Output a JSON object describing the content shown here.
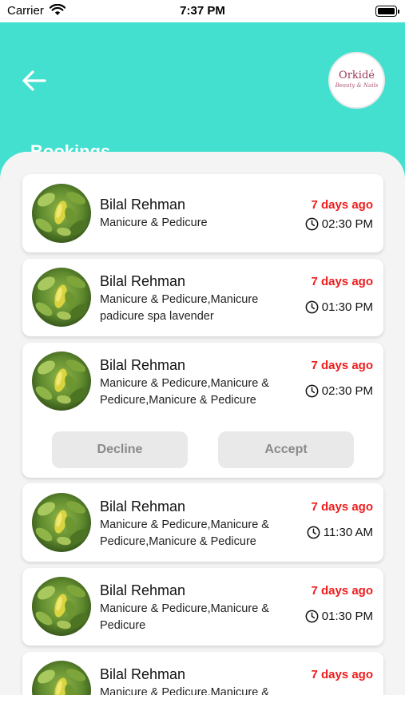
{
  "status_bar": {
    "carrier": "Carrier",
    "time": "7:37 PM"
  },
  "header": {
    "title": "Bookings",
    "logo": {
      "name": "Orkidé",
      "tagline": "Beauty & Nails"
    }
  },
  "colors": {
    "header_bg": "#43e0cf",
    "ago_red": "#ef1c1c",
    "button_gray": "#e9e9e9"
  },
  "icons": {
    "back": "arrow-left-icon",
    "clock": "clock-icon",
    "wifi": "wifi-icon",
    "battery": "battery-icon"
  },
  "bookings": [
    {
      "name": "Bilal Rehman",
      "service": "Manicure & Pedicure",
      "ago": "7 days ago",
      "time": "02:30 PM"
    },
    {
      "name": "Bilal Rehman",
      "service": "Manicure & Pedicure,Manicure padicure spa lavender",
      "ago": "7 days ago",
      "time": "01:30 PM"
    },
    {
      "name": "Bilal Rehman",
      "service": "Manicure & Pedicure,Manicure & Pedicure,Manicure & Pedicure",
      "ago": "7 days ago",
      "time": "02:30 PM",
      "decline_label": "Decline",
      "accept_label": "Accept"
    },
    {
      "name": "Bilal Rehman",
      "service": "Manicure & Pedicure,Manicure & Pedicure,Manicure & Pedicure",
      "ago": "7 days ago",
      "time": "11:30 AM"
    },
    {
      "name": "Bilal Rehman",
      "service": "Manicure & Pedicure,Manicure & Pedicure",
      "ago": "7 days ago",
      "time": "01:30 PM"
    },
    {
      "name": "Bilal Rehman",
      "service": "Manicure & Pedicure,Manicure &",
      "ago": "7 days ago",
      "time": ""
    }
  ]
}
